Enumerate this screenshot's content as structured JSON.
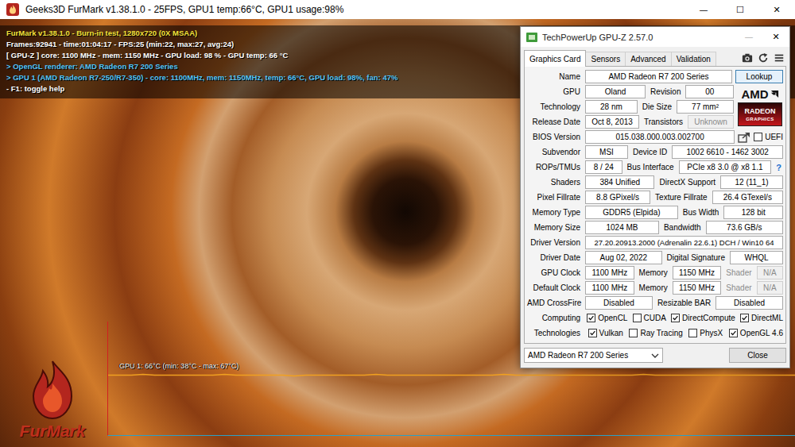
{
  "furmark": {
    "window": {
      "title": "Geeks3D FurMark v1.38.1.0 - 25FPS, GPU1 temp:66°C, GPU1 usage:98%",
      "controls": [
        {
          "kind": "minimize",
          "glyph": "—"
        },
        {
          "kind": "maximize",
          "glyph": "☐"
        },
        {
          "kind": "close",
          "glyph": "✕"
        }
      ]
    },
    "hud": [
      {
        "text": "FurMark v1.38.1.0 - Burn-in test, 1280x720 (0X MSAA)",
        "color": "#f2e23a"
      },
      {
        "text": "Frames:92941 - time:01:04:17 - FPS:25 (min:22, max:27, avg:24)",
        "color": "#ffffff"
      },
      {
        "text": "[ GPU-Z ] core: 1100 MHz - mem: 1150 MHz - GPU load: 98 % - GPU temp: 66 °C",
        "color": "#ffffff"
      },
      {
        "text": "> OpenGL renderer: AMD Radeon R7 200 Series",
        "color": "#4fc3f7"
      },
      {
        "text": "> GPU 1 (AMD Radeon R7-250/R7-350) - core: 1100MHz, mem: 1150MHz, temp: 66°C, GPU load: 98%, fan: 47%",
        "color": "#4fc3f7"
      },
      {
        "text": "- F1: toggle help",
        "color": "#ffffff"
      }
    ],
    "graph": {
      "label": "GPU 1: 66°C (min: 38°C - max: 67°C)",
      "series": [
        {
          "values": [
            66,
            66,
            66,
            67,
            66,
            66,
            66,
            66,
            66,
            66,
            67,
            66,
            66,
            66,
            66,
            66,
            65,
            66,
            66,
            66,
            66,
            66,
            66,
            67,
            66,
            66,
            66,
            66,
            66,
            66,
            66,
            66,
            66,
            66,
            67,
            66,
            66,
            66,
            66,
            66,
            66,
            66,
            66,
            66,
            66,
            66,
            67,
            66,
            66,
            66,
            66,
            66,
            66,
            66,
            66,
            66,
            66,
            66,
            66,
            66
          ]
        }
      ]
    },
    "logo": {
      "text": "FurMark"
    }
  },
  "gpuz": {
    "window": {
      "title": "TechPowerUp GPU-Z 2.57.0",
      "controls": [
        {
          "kind": "minimize",
          "glyph": "—",
          "disabled": true
        },
        {
          "kind": "close",
          "glyph": "✕",
          "disabled": false
        }
      ]
    },
    "tabs": [
      {
        "label": "Graphics Card",
        "selected": true
      },
      {
        "label": "Sensors",
        "selected": false
      },
      {
        "label": "Advanced",
        "selected": false
      },
      {
        "label": "Validation",
        "selected": false
      }
    ],
    "header_row": {
      "kind": "fields",
      "cells": [
        {
          "kind": "label",
          "text": "Name",
          "disabled": false
        },
        {
          "kind": "field",
          "text": "AMD Radeon R7 200 Series",
          "disabled": false
        },
        {
          "kind": "button",
          "text": "Lookup"
        }
      ]
    },
    "logo_rows": [
      {
        "kind": "fields",
        "cells": [
          {
            "kind": "label",
            "text": "GPU",
            "disabled": false
          },
          {
            "kind": "field",
            "text": "Oland",
            "disabled": false
          },
          {
            "kind": "label",
            "text": "Revision",
            "disabled": false
          },
          {
            "kind": "field",
            "text": "00",
            "disabled": false
          }
        ]
      },
      {
        "kind": "fields",
        "cells": [
          {
            "kind": "label",
            "text": "Technology",
            "disabled": false
          },
          {
            "kind": "field",
            "text": "28 nm",
            "disabled": false
          },
          {
            "kind": "label",
            "text": "Die Size",
            "disabled": false
          },
          {
            "kind": "field",
            "text": "77 mm²",
            "disabled": false
          }
        ]
      },
      {
        "kind": "fields",
        "cells": [
          {
            "kind": "label",
            "text": "Release Date",
            "disabled": false
          },
          {
            "kind": "field",
            "text": "Oct 8, 2013",
            "disabled": false
          },
          {
            "kind": "label",
            "text": "Transistors",
            "disabled": false
          },
          {
            "kind": "field",
            "text": "Unknown",
            "disabled": true
          }
        ]
      }
    ],
    "logo": {
      "brand": "AMD",
      "line1": "RADEON",
      "line2": "GRAPHICS"
    },
    "rows": [
      {
        "kind": "fields",
        "cells": [
          {
            "kind": "label",
            "text": "BIOS Version",
            "disabled": false
          },
          {
            "kind": "field",
            "text": "015.038.000.003.002700",
            "disabled": false
          },
          {
            "kind": "share"
          },
          {
            "kind": "check",
            "text": "UEFI",
            "checked": false
          }
        ]
      },
      {
        "kind": "fields",
        "cells": [
          {
            "kind": "label",
            "text": "Subvendor",
            "disabled": false
          },
          {
            "kind": "field",
            "text": "MSI",
            "disabled": false
          },
          {
            "kind": "label",
            "text": "Device ID",
            "disabled": false
          },
          {
            "kind": "field",
            "text": "1002 6610 - 1462 3002",
            "disabled": false
          }
        ]
      },
      {
        "kind": "fields",
        "cells": [
          {
            "kind": "label",
            "text": "ROPs/TMUs",
            "disabled": false
          },
          {
            "kind": "field",
            "text": "8 / 24",
            "disabled": false
          },
          {
            "kind": "label",
            "text": "Bus Interface",
            "disabled": false
          },
          {
            "kind": "field",
            "text": "PCIe x8 3.0 @ x8 1.1",
            "disabled": false
          },
          {
            "kind": "help",
            "text": "?"
          }
        ]
      },
      {
        "kind": "fields",
        "cells": [
          {
            "kind": "label",
            "text": "Shaders",
            "disabled": false
          },
          {
            "kind": "field",
            "text": "384 Unified",
            "disabled": false
          },
          {
            "kind": "label",
            "text": "DirectX Support",
            "disabled": false
          },
          {
            "kind": "field",
            "text": "12 (11_1)",
            "disabled": false
          }
        ]
      },
      {
        "kind": "fields",
        "cells": [
          {
            "kind": "label",
            "text": "Pixel Fillrate",
            "disabled": false
          },
          {
            "kind": "field",
            "text": "8.8 GPixel/s",
            "disabled": false
          },
          {
            "kind": "label",
            "text": "Texture Fillrate",
            "disabled": false
          },
          {
            "kind": "field",
            "text": "26.4 GTexel/s",
            "disabled": false
          }
        ]
      },
      {
        "kind": "fields",
        "cells": [
          {
            "kind": "label",
            "text": "Memory Type",
            "disabled": false
          },
          {
            "kind": "field",
            "text": "GDDR5 (Elpida)",
            "disabled": false
          },
          {
            "kind": "label",
            "text": "Bus Width",
            "disabled": false
          },
          {
            "kind": "field",
            "text": "128 bit",
            "disabled": false
          }
        ]
      },
      {
        "kind": "fields",
        "cells": [
          {
            "kind": "label",
            "text": "Memory Size",
            "disabled": false
          },
          {
            "kind": "field",
            "text": "1024 MB",
            "disabled": false
          },
          {
            "kind": "label",
            "text": "Bandwidth",
            "disabled": false
          },
          {
            "kind": "field",
            "text": "73.6 GB/s",
            "disabled": false
          }
        ]
      },
      {
        "kind": "fields",
        "cells": [
          {
            "kind": "label",
            "text": "Driver Version",
            "disabled": false
          },
          {
            "kind": "field",
            "text": "27.20.20913.2000 (Adrenalin 22.6.1) DCH / Win10 64",
            "disabled": false
          }
        ]
      },
      {
        "kind": "fields",
        "cells": [
          {
            "kind": "label",
            "text": "Driver Date",
            "disabled": false
          },
          {
            "kind": "field",
            "text": "Aug 02, 2022",
            "disabled": false
          },
          {
            "kind": "label",
            "text": "Digital Signature",
            "disabled": false
          },
          {
            "kind": "field",
            "text": "WHQL",
            "disabled": false
          }
        ]
      },
      {
        "kind": "fields",
        "cells": [
          {
            "kind": "label",
            "text": "GPU Clock",
            "disabled": false
          },
          {
            "kind": "field",
            "text": "1100 MHz",
            "disabled": false
          },
          {
            "kind": "label",
            "text": "Memory",
            "disabled": false
          },
          {
            "kind": "field",
            "text": "1150 MHz",
            "disabled": false
          },
          {
            "kind": "label",
            "text": "Shader",
            "disabled": true
          },
          {
            "kind": "field",
            "text": "N/A",
            "disabled": true
          }
        ]
      },
      {
        "kind": "fields",
        "cells": [
          {
            "kind": "label",
            "text": "Default Clock",
            "disabled": false
          },
          {
            "kind": "field",
            "text": "1100 MHz",
            "disabled": false
          },
          {
            "kind": "label",
            "text": "Memory",
            "disabled": false
          },
          {
            "kind": "field",
            "text": "1150 MHz",
            "disabled": false
          },
          {
            "kind": "label",
            "text": "Shader",
            "disabled": true
          },
          {
            "kind": "field",
            "text": "N/A",
            "disabled": true
          }
        ]
      },
      {
        "kind": "fields",
        "cells": [
          {
            "kind": "label",
            "text": "AMD CrossFire",
            "disabled": false
          },
          {
            "kind": "field",
            "text": "Disabled",
            "disabled": false
          },
          {
            "kind": "label",
            "text": "Resizable BAR",
            "disabled": false
          },
          {
            "kind": "field",
            "text": "Disabled",
            "disabled": false
          }
        ]
      },
      {
        "kind": "checks",
        "cells": [
          {
            "kind": "label",
            "text": "Computing",
            "disabled": false
          },
          {
            "kind": "check",
            "text": "OpenCL",
            "checked": true
          },
          {
            "kind": "check",
            "text": "CUDA",
            "checked": false
          },
          {
            "kind": "check",
            "text": "DirectCompute",
            "checked": true
          },
          {
            "kind": "check",
            "text": "DirectML",
            "checked": true
          }
        ]
      },
      {
        "kind": "checks",
        "cells": [
          {
            "kind": "label",
            "text": "Technologies",
            "disabled": false
          },
          {
            "kind": "check",
            "text": "Vulkan",
            "checked": true
          },
          {
            "kind": "check",
            "text": "Ray Tracing",
            "checked": false
          },
          {
            "kind": "check",
            "text": "PhysX",
            "checked": false
          },
          {
            "kind": "check",
            "text": "OpenGL 4.6",
            "checked": true
          }
        ]
      }
    ],
    "footer": {
      "dropdown": "AMD Radeon R7 200 Series",
      "close": "Close"
    }
  }
}
